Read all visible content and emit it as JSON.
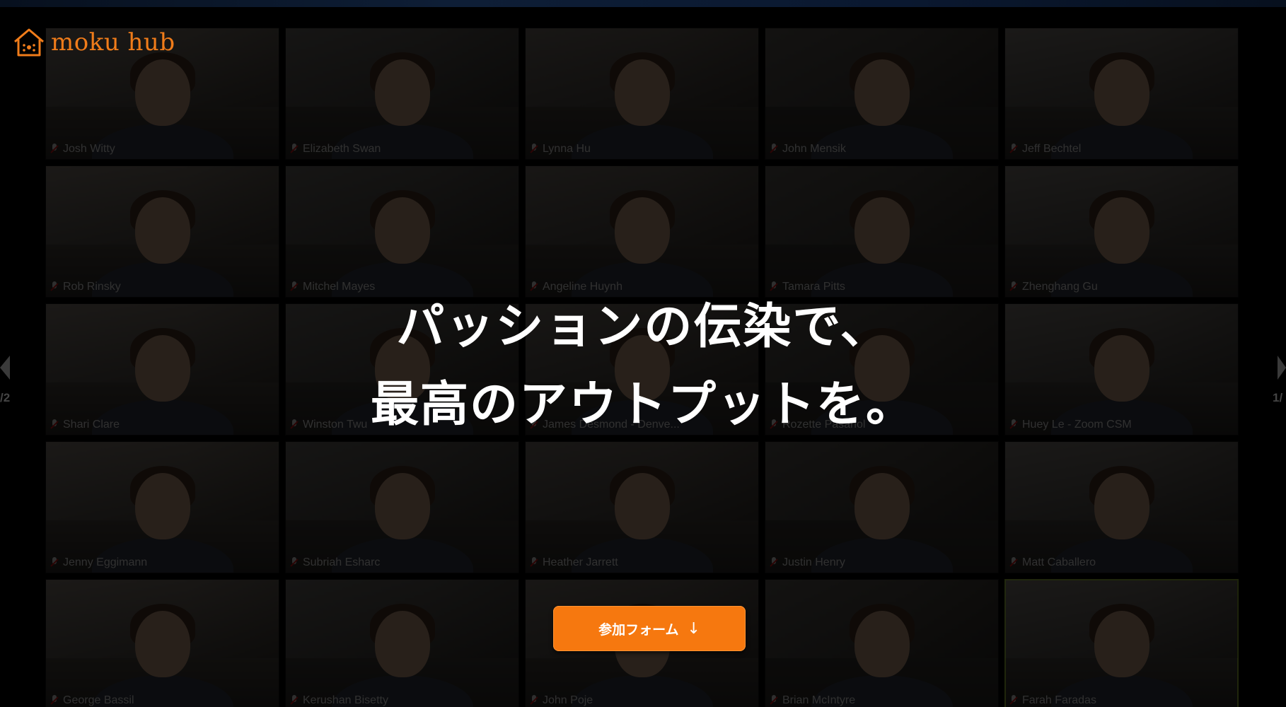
{
  "brand": {
    "logo_text": "moku hub",
    "logo_icon": "house-icon",
    "accent_color": "#f07c1a"
  },
  "hero": {
    "headline_line1": "パッションの伝染で、",
    "headline_line2": "最高のアウトプットを。",
    "cta_label": "参加フォーム",
    "cta_icon": "↓",
    "cta_color": "#f6780f"
  },
  "carousel": {
    "prev_page_label": "/2",
    "next_page_label": "1/",
    "prev_icon": "chevron-left-icon",
    "next_icon": "chevron-right-icon"
  },
  "participants": [
    {
      "name": "Josh Witty"
    },
    {
      "name": "Elizabeth Swan"
    },
    {
      "name": "Lynna Hu"
    },
    {
      "name": "John Mensik"
    },
    {
      "name": "Jeff Bechtel"
    },
    {
      "name": "Rob Rinsky"
    },
    {
      "name": "Mitchel Mayes"
    },
    {
      "name": "Angeline Huynh"
    },
    {
      "name": "Tamara Pitts"
    },
    {
      "name": "Zhenghang Gu"
    },
    {
      "name": "Shari Clare"
    },
    {
      "name": "Winston Twu"
    },
    {
      "name": "James Desmond - Denve..."
    },
    {
      "name": "Rozette Pasahol"
    },
    {
      "name": "Huey Le - Zoom CSM"
    },
    {
      "name": "Jenny Eggimann"
    },
    {
      "name": "Subriah Esharc"
    },
    {
      "name": "Heather Jarrett"
    },
    {
      "name": "Justin Henry"
    },
    {
      "name": "Matt Caballero"
    },
    {
      "name": "George Bassil"
    },
    {
      "name": "Kerushan Bisetty"
    },
    {
      "name": "John Poje"
    },
    {
      "name": "Brian McIntyre"
    },
    {
      "name": "Farah Faradas"
    }
  ]
}
